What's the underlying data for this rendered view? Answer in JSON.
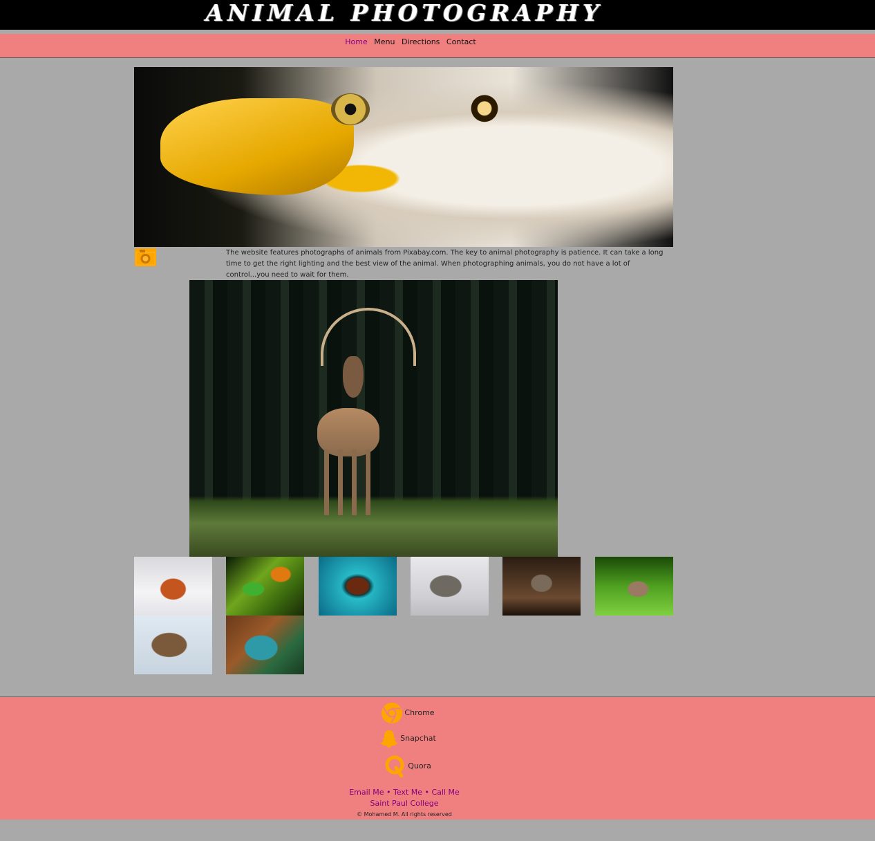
{
  "header": {
    "title": "ANIMAL PHOTOGRAPHY"
  },
  "nav": {
    "items": [
      {
        "label": "Home"
      },
      {
        "label": "Menu"
      },
      {
        "label": "Directions"
      },
      {
        "label": "Contact"
      }
    ]
  },
  "intro": {
    "icon": "camera-icon",
    "text": "The website features photographs of animals from Pixabay.com. The key to animal photography is patience. It can take a long time to get the right lighting and the best view of the animal. When photographing animals, you do not have a lot of control...you need to wait for them."
  },
  "images": {
    "hero": "eagle",
    "featured": "deer",
    "gallery": [
      "fox",
      "frog",
      "sea-turtle",
      "hedgehog",
      "jumping-spider",
      "rabbit",
      "ram",
      "lizard"
    ]
  },
  "footer": {
    "social": [
      {
        "label": "Chrome",
        "icon": "chrome-icon"
      },
      {
        "label": "Snapchat",
        "icon": "snapchat-icon"
      },
      {
        "label": "Quora",
        "icon": "quora-icon"
      }
    ],
    "contact_links": [
      {
        "label": "Email Me"
      },
      {
        "label": "Text Me"
      },
      {
        "label": "Call Me"
      }
    ],
    "separator": "•",
    "college": "Saint Paul College",
    "copyright": "© Mohamed M. All rights reserved"
  },
  "colors": {
    "header_bg": "#000000",
    "nav_bg": "#f08080",
    "page_bg": "#a9a9a9",
    "link": "#800080",
    "icon": "#ffa500"
  }
}
